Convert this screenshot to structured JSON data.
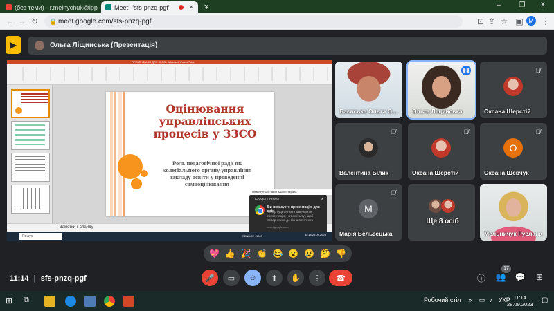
{
  "browser": {
    "tabs": [
      {
        "label": "(без теми) - r.melnychuk@ippo…",
        "active": false,
        "favicon_color": "#ea4335"
      },
      {
        "label": "Meet: \"sfs-pnzq-pgf\"",
        "active": true,
        "favicon_color": "#00897b"
      },
      {
        "label": "",
        "active": false,
        "favicon_color": ""
      }
    ],
    "new_tab": "+",
    "url": "meet.google.com/sfs-pnzq-pgf",
    "profile_initial": "M"
  },
  "meet": {
    "presenter_label": "Ольга Ліщинська (Презентація)",
    "room_code": "sfs-pnzq-pgf",
    "time": "11:14",
    "people_count": "17"
  },
  "presentation": {
    "window_title": "ПРЕЗЕНТАЦІЯ ДЛЯ ЗЗСО - Microsoft PowerPoint",
    "slide_title": "Оцінювання управлінських процесів у ЗЗСО",
    "slide_subtitle": "Роль педагогічної ради як колегіального органу управління закладу освіти у проведенні самооцінювання",
    "status_text": "Заметки к слайду",
    "share_notice": "Презентується вміст вашого екрана",
    "toast": {
      "app": "Google Chrome",
      "title": "Ви показуєте презентацію для всіх",
      "body": "Тепер будете гнати завершити презентацію, натисніть тут, щоб повернутися до вікна поточного",
      "footer": "meet.google.com"
    },
    "taskbar_search": "Пошук",
    "inner_clock": "11:14 28.09.2023",
    "weather": "SENDCX",
    "inner_temp": "+15°С"
  },
  "participants": [
    {
      "name": "Баєвська Ольга Олексі…",
      "muted": false,
      "speaking": false,
      "type": "photo"
    },
    {
      "name": "Ольга Ліщинська",
      "muted": false,
      "speaking": true,
      "type": "photo"
    },
    {
      "name": "Оксана Шерстій",
      "muted": true,
      "speaking": false,
      "type": "small-photo"
    },
    {
      "name": "Валентина Білик",
      "muted": true,
      "speaking": false,
      "type": "small-photo"
    },
    {
      "name": "Оксана Шерстій",
      "muted": true,
      "speaking": false,
      "type": "small-photo"
    },
    {
      "name": "Оксана Шевчук",
      "muted": true,
      "speaking": false,
      "type": "initial",
      "initial": "О",
      "color": "#e8710a"
    },
    {
      "name": "Марія Бельзецька",
      "muted": true,
      "speaking": false,
      "type": "initial",
      "initial": "М",
      "color": "#5f6368"
    },
    {
      "name": "Ще 8 осіб",
      "muted": false,
      "speaking": false,
      "type": "more"
    },
    {
      "name": "Мельничук Руслана",
      "muted": false,
      "speaking": false,
      "type": "photo"
    }
  ],
  "reactions": [
    "💖",
    "👍",
    "🎉",
    "👏",
    "😂",
    "😮",
    "😢",
    "🤔",
    "👎"
  ],
  "taskbar": {
    "desktop_label": "Робочий стіл",
    "lang": "УКР",
    "time": "11:14",
    "date": "28.09.2023"
  },
  "colors": {
    "meet_bg": "#202124",
    "tile_bg": "#3c4043",
    "hangup": "#ea4335",
    "accent": "#8ab4f8",
    "slide_title": "#b1362a",
    "slide_circle": "#f7941d"
  }
}
